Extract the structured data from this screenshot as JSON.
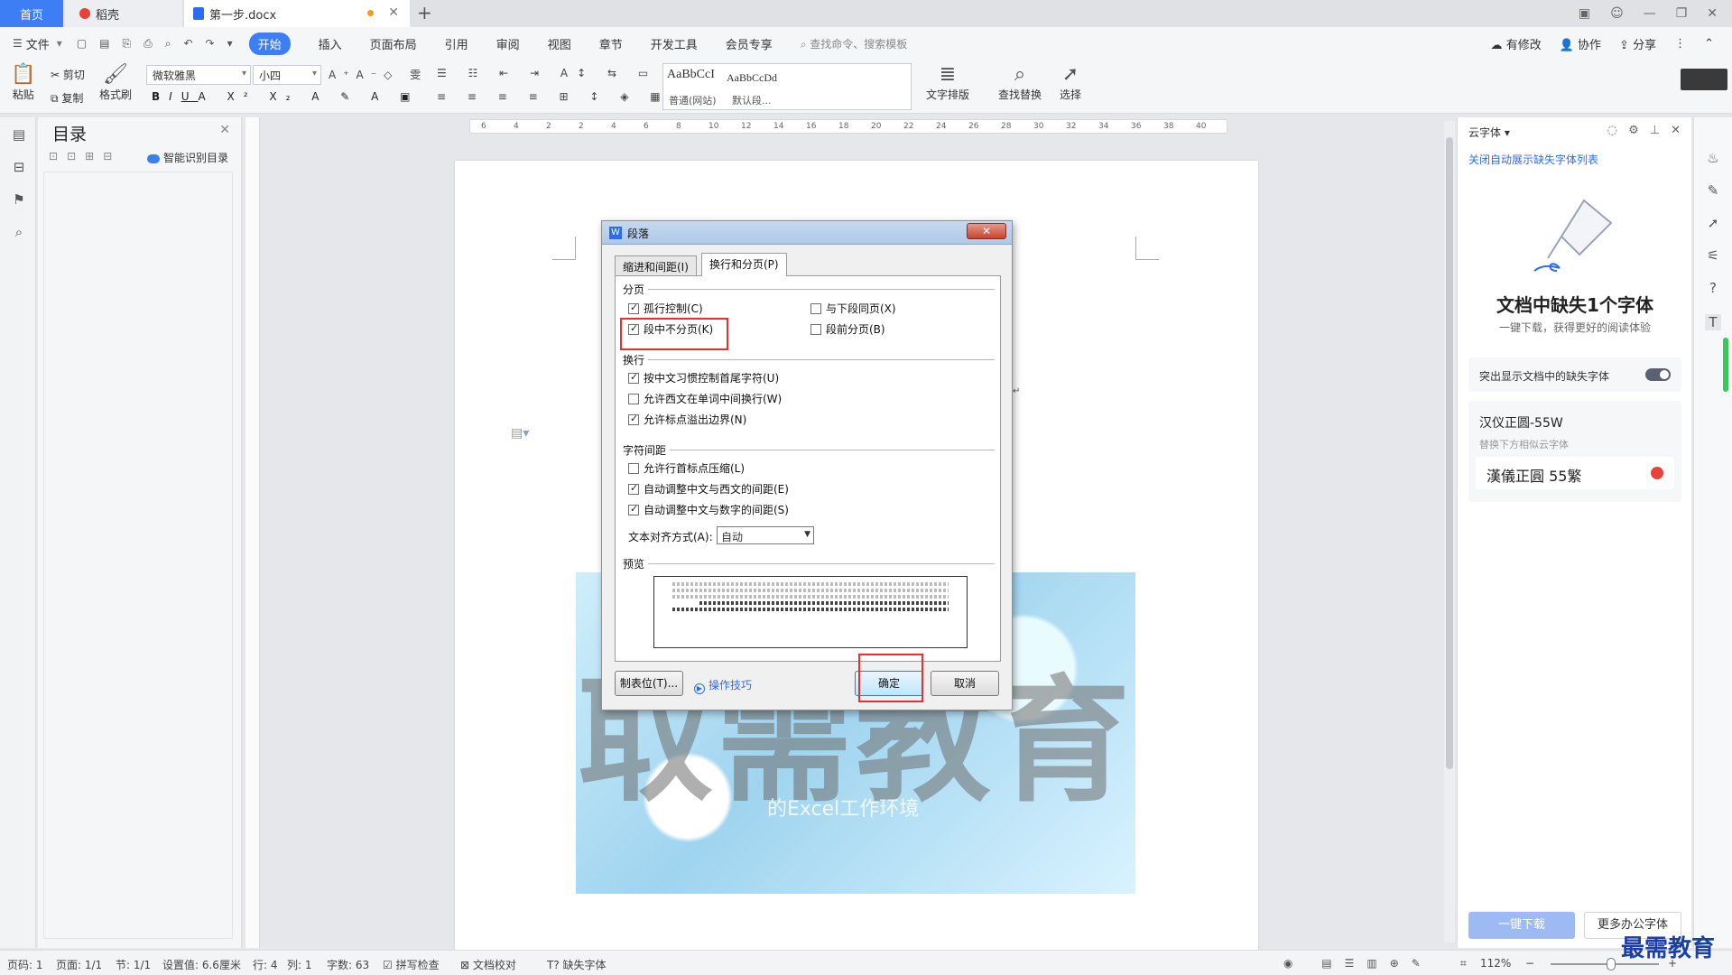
{
  "tabs": {
    "home": "首页",
    "daoke": "稻壳",
    "doc": "第一步.docx"
  },
  "menu": {
    "file": "文件",
    "items": [
      "开始",
      "插入",
      "页面布局",
      "引用",
      "审阅",
      "视图",
      "章节",
      "开发工具",
      "会员专享"
    ],
    "search_placeholder": "查找命令、搜索模板",
    "has_changes": "有修改",
    "collab": "协作",
    "share": "分享"
  },
  "ribbon": {
    "paste": "粘贴",
    "cut": "剪切",
    "copy": "复制",
    "format_painter": "格式刷",
    "font_name": "微软雅黑",
    "font_size": "小四",
    "style_sample_1": "AaBbCcI",
    "style_sample_2": "AaBbCcDd",
    "style_name_1": "普通(网站)",
    "style_name_2": "默认段...",
    "text_layout": "文字排版",
    "find_replace": "查找替换",
    "select": "选择"
  },
  "outline": {
    "title": "目录",
    "smart_toc": "智能识别目录"
  },
  "ruler_numbers": [
    "6",
    "4",
    "2",
    "2",
    "4",
    "6",
    "8",
    "10",
    "12",
    "14",
    "16",
    "18",
    "20",
    "22",
    "24",
    "26",
    "28",
    "30",
    "32",
    "34",
    "36",
    "38",
    "40"
  ],
  "document": {
    "hero_big": "取需教育",
    "hero_sub": "的Excel工作环境"
  },
  "dialog": {
    "title": "段落",
    "tab_indent": "缩进和间距(I)",
    "tab_breaks": "换行和分页(P)",
    "sec_pagination": "分页",
    "widow": "孤行控制(C)",
    "keep_next": "与下段同页(X)",
    "keep_lines": "段中不分页(K)",
    "page_break_before": "段前分页(B)",
    "sec_linebreak": "换行",
    "cjk_rules": "按中文习惯控制首尾字符(U)",
    "word_wrap": "允许西文在单词中间换行(W)",
    "hanging_punct": "允许标点溢出边界(N)",
    "sec_spacing": "字符间距",
    "compress_punct": "允许行首标点压缩(L)",
    "auto_space_latin": "自动调整中文与西文的间距(E)",
    "auto_space_digit": "自动调整中文与数字的间距(S)",
    "text_align_label": "文本对齐方式(A):",
    "text_align_value": "自动",
    "sec_preview": "预览",
    "tabs_button": "制表位(T)...",
    "tips": "操作技巧",
    "ok": "确定",
    "cancel": "取消"
  },
  "cloud_font": {
    "header": "云字体",
    "close_list": "关闭自动展示缺失字体列表",
    "title": "文档中缺失1个字体",
    "subtitle": "一键下载，获得更好的阅读体验",
    "highlight_toggle": "突出显示文档中的缺失字体",
    "missing_font": "汉仪正圆-55W",
    "replace_hint": "替换下方相似云字体",
    "alt_font": "漢儀正圓 55繁",
    "download_btn": "一键下载",
    "more_btn": "更多办公字体"
  },
  "status": {
    "page": "页码: 1",
    "pages": "页面: 1/1",
    "section": "节: 1/1",
    "setting": "设置值: 6.6厘米",
    "row": "行: 4",
    "col": "列: 1",
    "words": "字数: 63",
    "spell": "拼写检查",
    "proof": "文档校对",
    "missing_font": "缺失字体",
    "zoom": "112%"
  },
  "watermark": "最需教育",
  "colors": {
    "accent": "#3d7ef5",
    "highlight": "#e8312f"
  }
}
